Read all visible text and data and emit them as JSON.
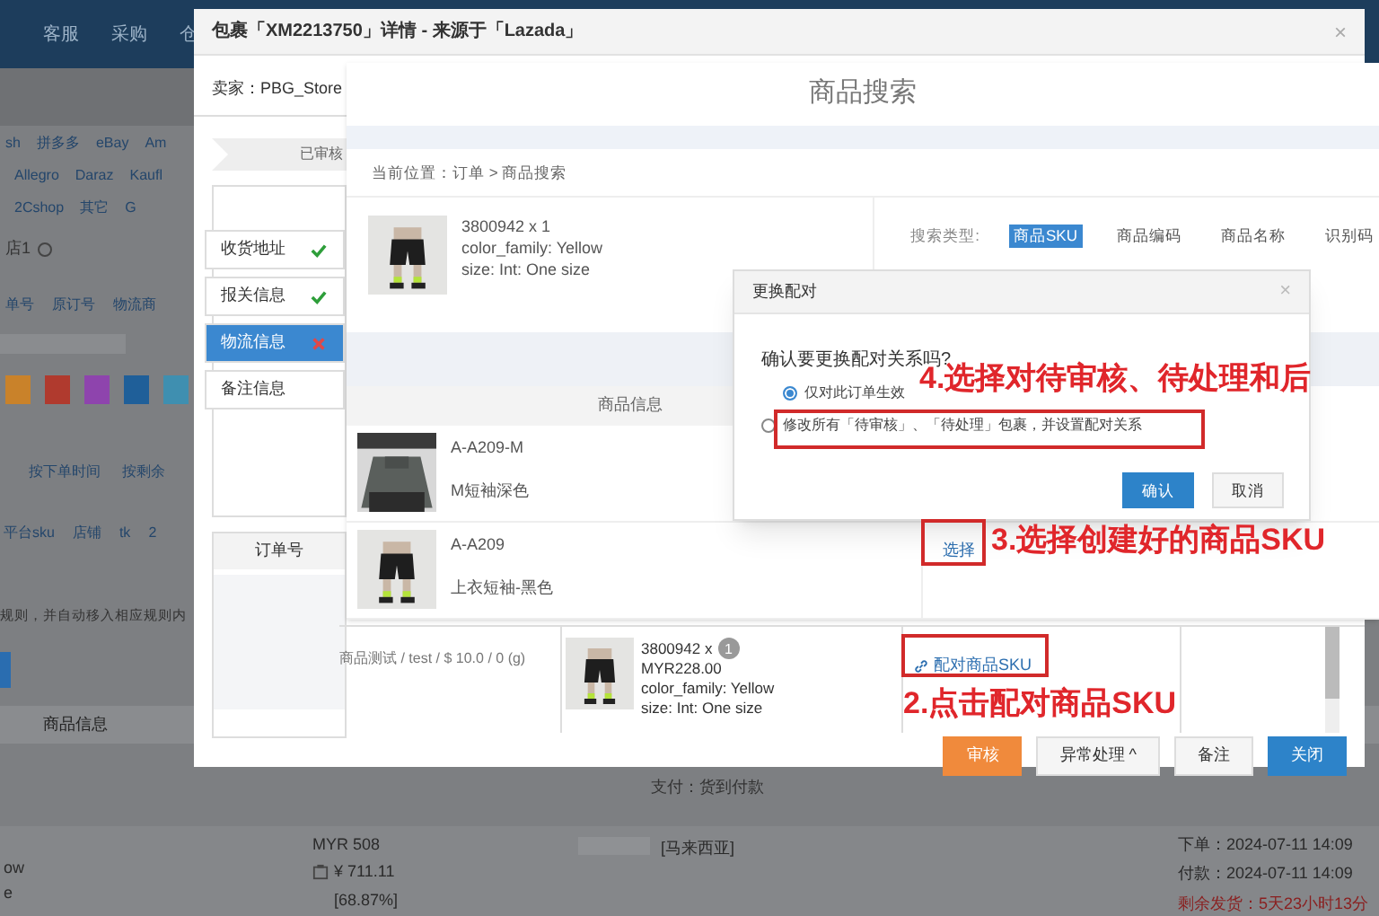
{
  "background_page": {
    "nav": [
      "客服",
      "采购",
      "仓"
    ],
    "platform_rows": [
      [
        "sh",
        "拼多多",
        "eBay",
        "Am"
      ],
      [
        "Allegro",
        "Daraz",
        "Kaufl"
      ],
      [
        "2Cshop",
        "其它",
        "G"
      ]
    ],
    "filter_tag": "店1",
    "search_fields": [
      "单号",
      "原订号",
      "物流商"
    ],
    "swatches": [
      {
        "color": "#c9822a"
      },
      {
        "color": "#b03a2e"
      },
      {
        "color": "#8e44ad"
      },
      {
        "color": "#1f5f99"
      },
      {
        "color": "#3f8fb0"
      }
    ],
    "sort_options": [
      "按下单时间",
      "按剩余"
    ],
    "columns": [
      "平台sku",
      "店铺",
      "tk",
      "2"
    ],
    "rule_note": "规则，并自动移入相应规则内",
    "table_header": "商品信息",
    "payment": "支付：货到付款",
    "order_row": {
      "lines": [
        "ow",
        "e"
      ],
      "amount": "MYR 508",
      "cny": "¥ 711.11",
      "ratio": "[68.87%]",
      "country": "[马来西亚]",
      "ordered": "下单：2024-07-11 14:09",
      "paid": "付款：2024-07-11 14:09",
      "remaining": "剩余发货：5天23小时13分"
    }
  },
  "order_modal": {
    "title": "包裹「XM2213750」详情 - 来源于「Lazada」",
    "close": "×",
    "seller": "卖家：PBG_Store",
    "status": "已审核",
    "steps": [
      {
        "label": "收货地址",
        "ok": true,
        "selected": false
      },
      {
        "label": "报关信息",
        "ok": true,
        "selected": false
      },
      {
        "label": "物流信息",
        "ok": false,
        "selected": true
      },
      {
        "label": "备注信息",
        "selected": false
      }
    ],
    "order_no_header": "订单号",
    "product_line": "商品测试 / test / $ 10.0 / 0 (g)",
    "item": {
      "lines": [
        "3800942 x",
        "MYR228.00",
        "color_family:  Yellow",
        "size:  Int: One size"
      ],
      "qty": "1"
    },
    "pair_link": "配对商品SKU",
    "buttons": [
      {
        "label": "审核",
        "kind": "warning"
      },
      {
        "label": "异常处理 ^",
        "kind": "default"
      },
      {
        "label": "备注",
        "kind": "default"
      },
      {
        "label": "关闭",
        "kind": "primary"
      }
    ]
  },
  "search_modal": {
    "title": "商品搜索",
    "breadcrumb": "当前位置：订单 > 商品搜索",
    "product": {
      "lines": [
        "3800942 x  1",
        "color_family:  Yellow",
        "size:  Int: One size"
      ]
    },
    "search_type_label": "搜索类型:",
    "search_types": [
      {
        "label": "商品SKU",
        "selected": true
      },
      {
        "label": "商品编码",
        "selected": false
      },
      {
        "label": "商品名称",
        "selected": false
      },
      {
        "label": "识别码",
        "selected": false
      }
    ],
    "table_header": "商品信息",
    "rows": [
      {
        "sku": "A-A209-M",
        "name": "M短袖深色"
      },
      {
        "sku": "A-A209",
        "name": "上衣短袖-黑色",
        "action": "选择"
      }
    ]
  },
  "confirm_dialog": {
    "title": "更换配对",
    "close": "×",
    "question": "确认要更换配对关系吗?",
    "options": [
      {
        "label": "仅对此订单生效",
        "selected": true
      },
      {
        "label": "修改所有「待审核」、「待处理」包裹，并设置配对关系",
        "selected": false
      }
    ],
    "buttons": [
      {
        "label": "确认",
        "kind": "primary"
      },
      {
        "label": "取消",
        "kind": "default"
      }
    ]
  },
  "annotations": [
    "4.选择对待审核、待处理和后",
    "3.选择创建好的商品SKU",
    "2.点击配对商品SKU"
  ]
}
